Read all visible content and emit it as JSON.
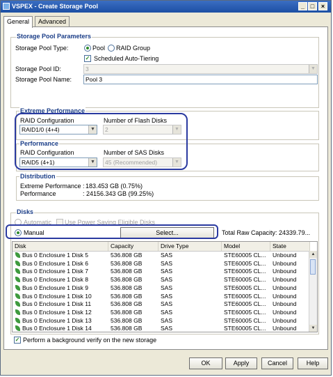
{
  "window": {
    "title": "VSPEX - Create Storage Pool",
    "controls": {
      "minimize": "_",
      "maximize": "□",
      "close": "×"
    }
  },
  "tabs": [
    {
      "label": "General",
      "active": true
    },
    {
      "label": "Advanced",
      "active": false
    }
  ],
  "params": {
    "title": "Storage Pool Parameters",
    "type_label": "Storage Pool Type:",
    "pool_option": "Pool",
    "raid_group_option": "RAID Group",
    "auto_tiering_label": "Scheduled Auto-Tiering",
    "id_label": "Storage Pool ID:",
    "id_value": "3",
    "name_label": "Storage Pool Name:",
    "name_value": "Pool 3"
  },
  "extreme": {
    "title": "Extreme Performance",
    "raid_label": "RAID Configuration",
    "raid_value": "RAID1/0 (4+4)",
    "disks_label": "Number of Flash Disks",
    "disks_value": "2"
  },
  "performance": {
    "title": "Performance",
    "raid_label": "RAID Configuration",
    "raid_value": "RAID5 (4+1)",
    "disks_label": "Number of SAS Disks",
    "disks_value": "45 (Recommended)"
  },
  "distribution": {
    "title": "Distribution",
    "extreme_label": "Extreme Performance :",
    "extreme_value": "183.453 GB (0.75%)",
    "performance_label": "Performance",
    "performance_value": ": 24156.343 GB (99.25%)"
  },
  "disks": {
    "title": "Disks",
    "automatic_label": "Automatic",
    "power_saving_label": "Use Power Saving Eligible Disks",
    "manual_label": "Manual",
    "select_button": "Select...",
    "total_raw": "Total Raw Capacity: 24339.79...",
    "columns": [
      "Disk",
      "Capacity",
      "Drive Type",
      "Model",
      "State"
    ],
    "rows": [
      [
        "Bus 0 Enclosure 1 Disk 5",
        "536.808 GB",
        "SAS",
        "STE60005 CL...",
        "Unbound"
      ],
      [
        "Bus 0 Enclosure 1 Disk 6",
        "536.808 GB",
        "SAS",
        "STE60005 CL...",
        "Unbound"
      ],
      [
        "Bus 0 Enclosure 1 Disk 7",
        "536.808 GB",
        "SAS",
        "STE60005 CL...",
        "Unbound"
      ],
      [
        "Bus 0 Enclosure 1 Disk 8",
        "536.808 GB",
        "SAS",
        "STE60005 CL...",
        "Unbound"
      ],
      [
        "Bus 0 Enclosure 1 Disk 9",
        "536.808 GB",
        "SAS",
        "STE60005 CL...",
        "Unbound"
      ],
      [
        "Bus 0 Enclosure 1 Disk 10",
        "536.808 GB",
        "SAS",
        "STE60005 CL...",
        "Unbound"
      ],
      [
        "Bus 0 Enclosure 1 Disk 11",
        "536.808 GB",
        "SAS",
        "STE60005 CL...",
        "Unbound"
      ],
      [
        "Bus 0 Enclosure 1 Disk 12",
        "536.808 GB",
        "SAS",
        "STE60005 CL...",
        "Unbound"
      ],
      [
        "Bus 0 Enclosure 1 Disk 13",
        "536.808 GB",
        "SAS",
        "STE60005 CL...",
        "Unbound"
      ],
      [
        "Bus 0 Enclosure 1 Disk 14",
        "536.808 GB",
        "SAS",
        "STE60005 CL...",
        "Unbound"
      ]
    ]
  },
  "verify_label": "Perform a background verify on the new storage",
  "buttons": {
    "ok": "OK",
    "apply": "Apply",
    "cancel": "Cancel",
    "help": "Help"
  },
  "colors": {
    "title_bar": "#1c4fa4",
    "group_title": "#1a3d87",
    "highlight": "#2a3aa0",
    "disk_icon": "#3e9a3e"
  }
}
